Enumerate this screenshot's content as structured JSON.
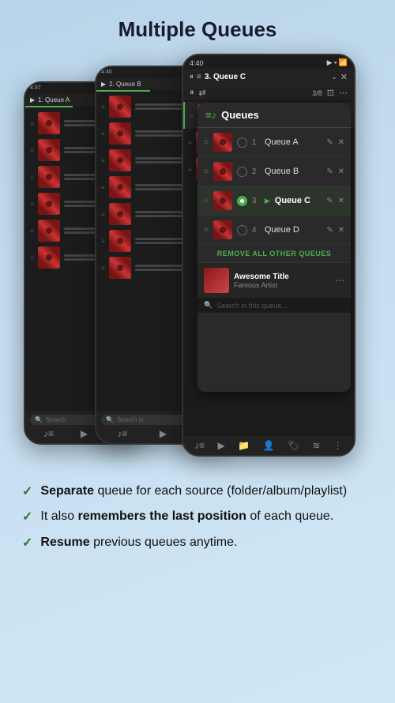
{
  "page": {
    "title": "Multiple Queues"
  },
  "phone1": {
    "time": "4:37",
    "queue_label": "1. Queue A",
    "tracks_count": 6
  },
  "phone2": {
    "time": "4:40",
    "queue_label": "2. Queue B",
    "tracks_count": 7
  },
  "phone3": {
    "time": "4:40",
    "queue_label": "3. Queue C",
    "track_count": "3/8",
    "queues_panel_title": "Queues",
    "queues": [
      {
        "num": "1",
        "name": "Queue A",
        "active": false
      },
      {
        "num": "2",
        "name": "Queue B",
        "active": false
      },
      {
        "num": "3",
        "name": "Queue C",
        "active": true
      },
      {
        "num": "4",
        "name": "Queue D",
        "active": false
      }
    ],
    "remove_all_label": "REMOVE ALL OTHER QUEUES",
    "now_playing_title": "Awesome Title",
    "now_playing_artist": "Famous Artist",
    "search_placeholder": "Search in this queue..."
  },
  "features": [
    {
      "bold_part": "Separate",
      "rest": " queue for each source (folder/album/playlist)"
    },
    {
      "bold_part": null,
      "text_before": "It also ",
      "bold_part2": "remembers the last position",
      "rest": " of each queue."
    },
    {
      "bold_part": "Resume",
      "rest": " previous queues anytime."
    }
  ],
  "icons": {
    "check": "✓",
    "play": "▶",
    "pause": "⏸",
    "shuffle": "⇄",
    "save": "💾",
    "more": "⋯",
    "search": "🔍",
    "queue": "≡♪",
    "drag": "≡",
    "edit": "✎",
    "delete": "✕",
    "chevron_down": "⌄",
    "close": "✕",
    "music_note": "♪",
    "folder": "📁",
    "person": "👤",
    "tag": "🏷",
    "equalizer": "≋"
  }
}
